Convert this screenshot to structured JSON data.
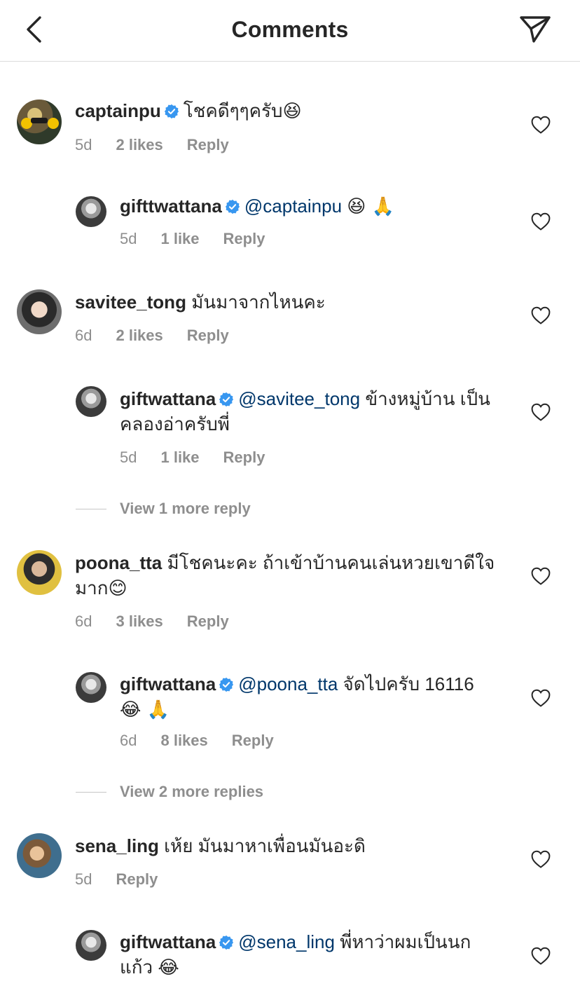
{
  "header": {
    "title": "Comments",
    "back_icon": "chevron-left-icon",
    "share_icon": "paper-plane-icon"
  },
  "colors": {
    "verified": "#3897f0",
    "mention": "#00376b",
    "muted": "#8e8e8e",
    "text": "#262626",
    "divider": "#dbdbdb"
  },
  "comments": [
    {
      "username": "captainpu",
      "verified": true,
      "text": "โชคดีๆๆครับ",
      "emoji": "😆",
      "time": "5d",
      "likes": "2 likes",
      "reply": "Reply"
    },
    {
      "username": "gifttwattana",
      "verified": true,
      "mention": "@captainpu",
      "text": "",
      "emoji": "😆 🙏",
      "time": "5d",
      "likes": "1 like",
      "reply": "Reply"
    },
    {
      "username": "savitee_tong",
      "verified": false,
      "text": "มันมาจากไหนคะ",
      "time": "6d",
      "likes": "2 likes",
      "reply": "Reply"
    },
    {
      "username": "giftwattana",
      "verified": true,
      "mention": "@savitee_tong",
      "text": "ข้างหมู่บ้าน เป็นคลองอ่าครับพี่",
      "time": "5d",
      "likes": "1 like",
      "reply": "Reply"
    },
    {
      "username": "poona_tta",
      "verified": false,
      "text": "มีโชคนะคะ ถ้าเข้าบ้านคนเล่นหวยเขาดีใจมาก",
      "emoji": "😊",
      "time": "6d",
      "likes": "3 likes",
      "reply": "Reply"
    },
    {
      "username": "giftwattana",
      "verified": true,
      "mention": "@poona_tta",
      "text": "จัดไปครับ 16116",
      "emoji": "😂 🙏",
      "time": "6d",
      "likes": "8 likes",
      "reply": "Reply"
    },
    {
      "username": "sena_ling",
      "verified": false,
      "text": "เห้ย มันมาหาเพื่อนมันอะดิ",
      "time": "5d",
      "reply": "Reply"
    },
    {
      "username": "giftwattana",
      "verified": true,
      "mention": "@sena_ling",
      "text": "พี่หาว่าผมเป็นนกแก้ว",
      "emoji": "😂"
    }
  ],
  "view_more": [
    "View 1 more reply",
    "View 2 more replies"
  ]
}
